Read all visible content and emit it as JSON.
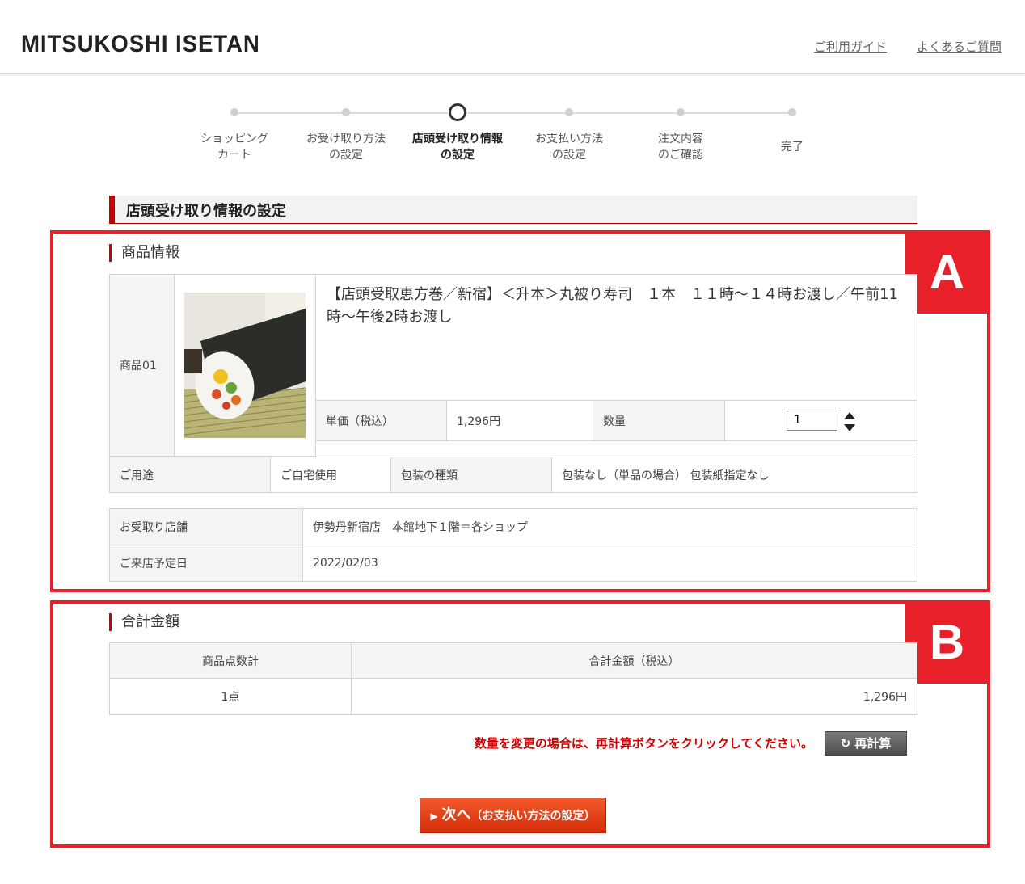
{
  "header": {
    "logo": "MITSUKOSHI ISETAN",
    "links": [
      "ご利用ガイド",
      "よくあるご質問"
    ]
  },
  "steps": [
    {
      "line1": "ショッピング",
      "line2": "カート"
    },
    {
      "line1": "お受け取り方法",
      "line2": "の設定"
    },
    {
      "line1": "店頭受け取り情報",
      "line2": "の設定"
    },
    {
      "line1": "お支払い方法",
      "line2": "の設定"
    },
    {
      "line1": "注文内容",
      "line2": "のご確認"
    },
    {
      "line1": "完了",
      "line2": ""
    }
  ],
  "current_step": 3,
  "page_title": "店頭受け取り情報の設定",
  "section_a": {
    "badge": "A",
    "title": "商品情報",
    "item_label": "商品01",
    "product_name": "【店頭受取恵方巻／新宿】＜升本＞丸被り寿司　１本　１１時～１４時お渡し／午前11時～午後2時お渡し",
    "unit_price_label": "単価（税込）",
    "unit_price": "1,296円",
    "qty_label": "数量",
    "qty_value": "1",
    "usage_label": "ご用途",
    "usage_value": "ご自宅使用",
    "wrap_label": "包装の種類",
    "wrap_value": "包装なし（単品の場合） 包装紙指定なし",
    "store_label": "お受取り店舗",
    "store_value": "伊勢丹新宿店　本館地下１階＝各ショップ",
    "date_label": "ご来店予定日",
    "date_value": "2022/02/03"
  },
  "section_b": {
    "badge": "B",
    "title": "合計金額",
    "count_header": "商品点数計",
    "total_header": "合計金額（税込）",
    "count_value": "1点",
    "total_value": "1,296円",
    "warning": "数量を変更の場合は、再計算ボタンをクリックしてください。",
    "recalc_label": "再計算",
    "next_main": "次へ",
    "next_sub": "（お支払い方法の設定）"
  },
  "colors": {
    "accent_red": "#e8202a",
    "brand_red": "#cc0000",
    "button_orange": "#e8401a"
  }
}
